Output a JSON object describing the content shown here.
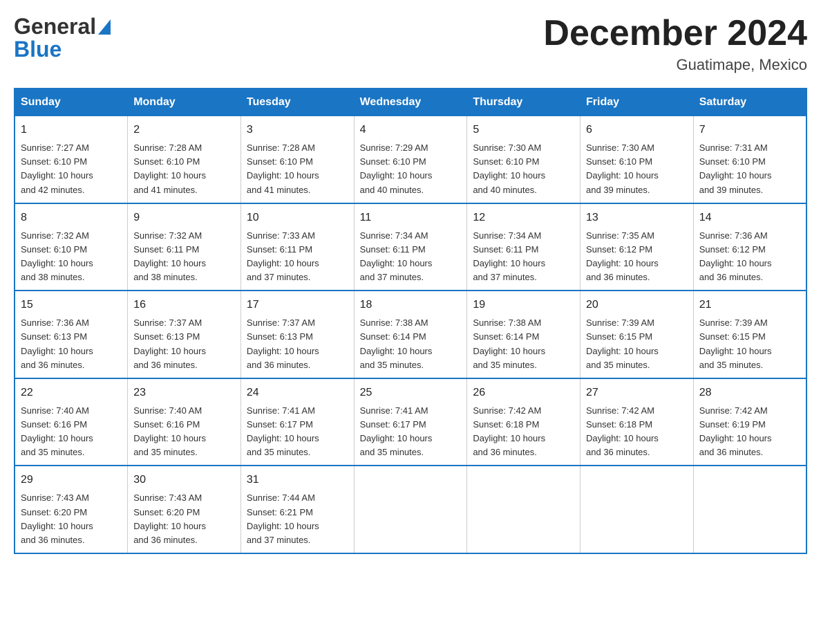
{
  "header": {
    "logo_general": "General",
    "logo_blue": "Blue",
    "month_title": "December 2024",
    "location": "Guatimape, Mexico"
  },
  "weekdays": [
    "Sunday",
    "Monday",
    "Tuesday",
    "Wednesday",
    "Thursday",
    "Friday",
    "Saturday"
  ],
  "weeks": [
    [
      {
        "day": "1",
        "sunrise": "7:27 AM",
        "sunset": "6:10 PM",
        "daylight": "10 hours and 42 minutes."
      },
      {
        "day": "2",
        "sunrise": "7:28 AM",
        "sunset": "6:10 PM",
        "daylight": "10 hours and 41 minutes."
      },
      {
        "day": "3",
        "sunrise": "7:28 AM",
        "sunset": "6:10 PM",
        "daylight": "10 hours and 41 minutes."
      },
      {
        "day": "4",
        "sunrise": "7:29 AM",
        "sunset": "6:10 PM",
        "daylight": "10 hours and 40 minutes."
      },
      {
        "day": "5",
        "sunrise": "7:30 AM",
        "sunset": "6:10 PM",
        "daylight": "10 hours and 40 minutes."
      },
      {
        "day": "6",
        "sunrise": "7:30 AM",
        "sunset": "6:10 PM",
        "daylight": "10 hours and 39 minutes."
      },
      {
        "day": "7",
        "sunrise": "7:31 AM",
        "sunset": "6:10 PM",
        "daylight": "10 hours and 39 minutes."
      }
    ],
    [
      {
        "day": "8",
        "sunrise": "7:32 AM",
        "sunset": "6:10 PM",
        "daylight": "10 hours and 38 minutes."
      },
      {
        "day": "9",
        "sunrise": "7:32 AM",
        "sunset": "6:11 PM",
        "daylight": "10 hours and 38 minutes."
      },
      {
        "day": "10",
        "sunrise": "7:33 AM",
        "sunset": "6:11 PM",
        "daylight": "10 hours and 37 minutes."
      },
      {
        "day": "11",
        "sunrise": "7:34 AM",
        "sunset": "6:11 PM",
        "daylight": "10 hours and 37 minutes."
      },
      {
        "day": "12",
        "sunrise": "7:34 AM",
        "sunset": "6:11 PM",
        "daylight": "10 hours and 37 minutes."
      },
      {
        "day": "13",
        "sunrise": "7:35 AM",
        "sunset": "6:12 PM",
        "daylight": "10 hours and 36 minutes."
      },
      {
        "day": "14",
        "sunrise": "7:36 AM",
        "sunset": "6:12 PM",
        "daylight": "10 hours and 36 minutes."
      }
    ],
    [
      {
        "day": "15",
        "sunrise": "7:36 AM",
        "sunset": "6:13 PM",
        "daylight": "10 hours and 36 minutes."
      },
      {
        "day": "16",
        "sunrise": "7:37 AM",
        "sunset": "6:13 PM",
        "daylight": "10 hours and 36 minutes."
      },
      {
        "day": "17",
        "sunrise": "7:37 AM",
        "sunset": "6:13 PM",
        "daylight": "10 hours and 36 minutes."
      },
      {
        "day": "18",
        "sunrise": "7:38 AM",
        "sunset": "6:14 PM",
        "daylight": "10 hours and 35 minutes."
      },
      {
        "day": "19",
        "sunrise": "7:38 AM",
        "sunset": "6:14 PM",
        "daylight": "10 hours and 35 minutes."
      },
      {
        "day": "20",
        "sunrise": "7:39 AM",
        "sunset": "6:15 PM",
        "daylight": "10 hours and 35 minutes."
      },
      {
        "day": "21",
        "sunrise": "7:39 AM",
        "sunset": "6:15 PM",
        "daylight": "10 hours and 35 minutes."
      }
    ],
    [
      {
        "day": "22",
        "sunrise": "7:40 AM",
        "sunset": "6:16 PM",
        "daylight": "10 hours and 35 minutes."
      },
      {
        "day": "23",
        "sunrise": "7:40 AM",
        "sunset": "6:16 PM",
        "daylight": "10 hours and 35 minutes."
      },
      {
        "day": "24",
        "sunrise": "7:41 AM",
        "sunset": "6:17 PM",
        "daylight": "10 hours and 35 minutes."
      },
      {
        "day": "25",
        "sunrise": "7:41 AM",
        "sunset": "6:17 PM",
        "daylight": "10 hours and 35 minutes."
      },
      {
        "day": "26",
        "sunrise": "7:42 AM",
        "sunset": "6:18 PM",
        "daylight": "10 hours and 36 minutes."
      },
      {
        "day": "27",
        "sunrise": "7:42 AM",
        "sunset": "6:18 PM",
        "daylight": "10 hours and 36 minutes."
      },
      {
        "day": "28",
        "sunrise": "7:42 AM",
        "sunset": "6:19 PM",
        "daylight": "10 hours and 36 minutes."
      }
    ],
    [
      {
        "day": "29",
        "sunrise": "7:43 AM",
        "sunset": "6:20 PM",
        "daylight": "10 hours and 36 minutes."
      },
      {
        "day": "30",
        "sunrise": "7:43 AM",
        "sunset": "6:20 PM",
        "daylight": "10 hours and 36 minutes."
      },
      {
        "day": "31",
        "sunrise": "7:44 AM",
        "sunset": "6:21 PM",
        "daylight": "10 hours and 37 minutes."
      },
      null,
      null,
      null,
      null
    ]
  ],
  "labels": {
    "sunrise": "Sunrise:",
    "sunset": "Sunset:",
    "daylight": "Daylight:"
  }
}
